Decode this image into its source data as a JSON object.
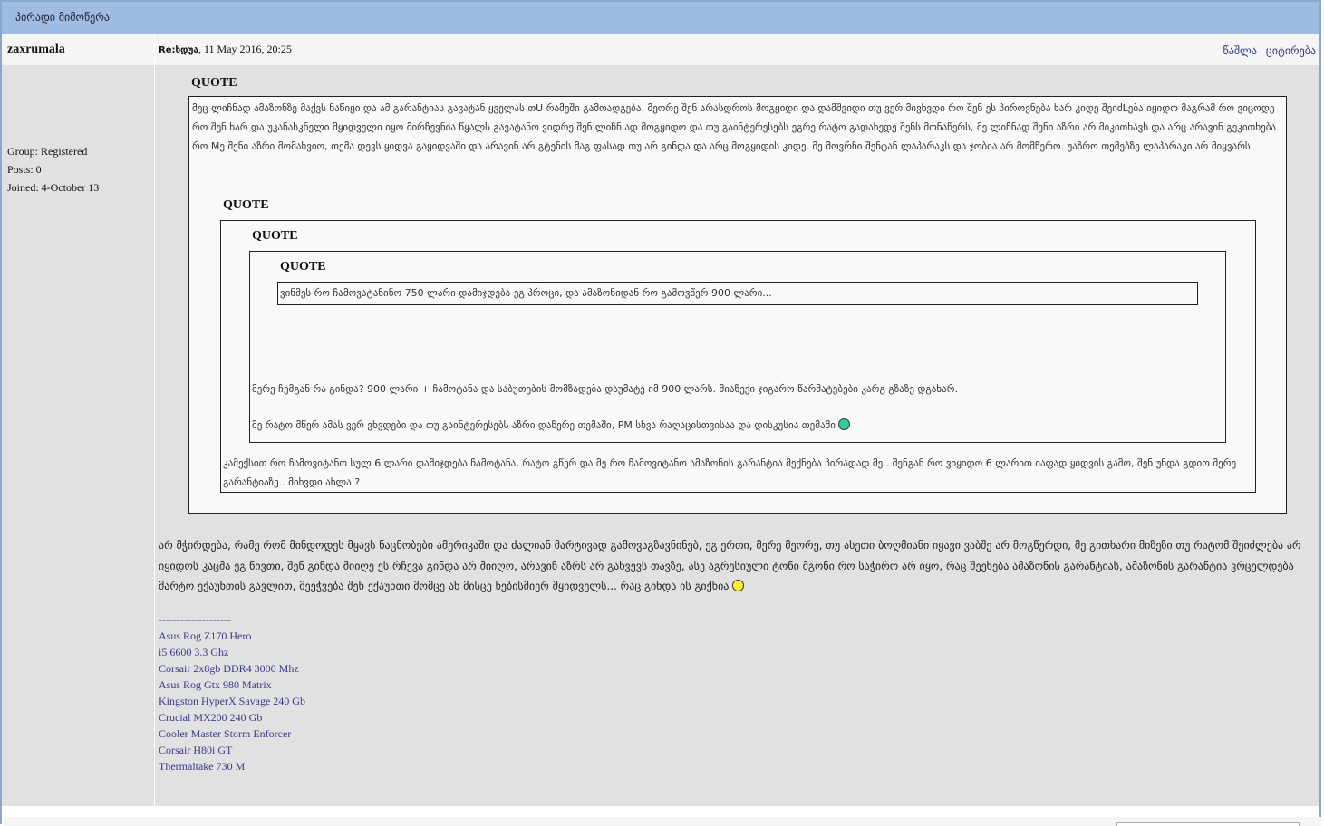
{
  "header": {
    "title": "პირადი მიმოწერა"
  },
  "post": {
    "author": "zaxrumala",
    "subject_prefix": "Re:",
    "subject": "ხდუა",
    "date": ", 11 May 2016, 20:25",
    "actions": {
      "delete": "წაშლა",
      "quote": "ციტირება"
    },
    "user_info": {
      "group": "Group: Registered",
      "posts": "Posts: 0",
      "joined": "Joined: 4-October 13"
    },
    "quote_label": "QUOTE",
    "quote1_text": "მეც ლიჩნად ამაზონზე მაქვს ნაწიყი და ამ გარანტიას გავატან ყველას თU რამეში გამოადგება. მეორე შენ არასდროს მოგყიდი და დამშვიდი თუ ვერ მივხვდი რო შენ ეს პიროვნება ხარ კიდე შეიძLება იყიდო მაგრამ რო ვიცოდე რო შენ ხარ და უკანასკნელი მყიდველი იყო მირჩევნია წყალს გავატანო ვიდრე შენ ლიჩნ ად მოგყიდო და თუ გაინტერესებს ეგრე რატო გადახედე შენს მონაწერს, მე ლიჩნად შენი აზრი არ მიკითხავს და არც არავინ გეკითხება რო Mე შენი აზრი მომახვიო, თემა დევს ყიდვა გაყიდვაში და არავინ არ გტენის მაგ ფასად თუ არ გინდა და არც მოგყიდის კიდე. მე მოვრჩი შენტან ლაპარაკს და ჯობია არ მომწერო. უაზრო თემებზე ლაპარაკი არ მიყვარს",
    "quote4_text": "ვინმეს რო ჩამოვატანინო 750 ლარი დამიჯდება ეგ პროცი, და ამაზონიდან რო გამოვწერ 900 ლარი...",
    "quote3_para1": "მერე ჩემგან რა გინდა? 900 ლარი + ჩამოტანა და საბუთების მომზადება დაუმატე იმ 900 ლარს. მიაწექი ჯიგარო წარმატებები კარგ გზაზე დგახარ.",
    "quote3_para2": "მე რატო მწერ ამას ვერ ვხვდები და თუ გაინტერესებს აზრი დაწერე თემაში, PM სხვა რაღაცისთვისაა და დისკუსია თემაში",
    "quote2_text": "კამექსით რო ჩამოვიტანო სულ 6 ლარი დამიჯდება ჩამოტანა, რატო გწერ და მე რო ჩამოვიტანო ამაზონის გარანტია მექნება პირადად მე.. შენგან რო ვიყიდო 6 ლარით იაფად ყიდვის გამო, შენ უნდა გდიო მერე გარანტიაზე.. მიხვდი ახლა ?",
    "body_text": "არ მჭირდება, რამე რომ მინდოდეს მყავს ნაცნობები ამერიკაში და ძალიან მარტივად გამოვაგზავნინებ, ეგ ერთი, მერე მეორე, თუ ასეთი ბოღმიანი იყავი ვაბშე არ მოგწერდი, მე გითხარი მიზეზი თუ რატომ შეიძლება არ იყიდოს კაცმა ეგ ნივთი, შენ გინდა მიიღე ეს რჩევა გინდა არ მიიღო, არავინ აზრს არ გახვევს თავზე, ასე აგრესიული ტონი მგონი რო საჭირო არ იყო, რაც შეეხება ამაზონის გარანტიას, ამაზონის გარანტია ვრცელდება მარტო ექაუნთის გავლით, მეეჭვება შენ ექაუნთი მომცე ან მისცე ნებისმიერ მყიდველს... რაც გინდა ის გიქნია",
    "signature": {
      "divider": "--------------------",
      "lines": [
        "Asus Rog Z170 Hero",
        "i5 6600 3.3 Ghz",
        "Corsair 2x8gb DDR4 3000 Mhz",
        "Asus Rog Gtx 980 Matrix",
        "Kingston HyperX Savage 240 Gb",
        "Crucial MX200 240 Gb",
        "Cooler Master Storm Enforcer",
        "Corsair H80i GT",
        "Thermaltake 730 M"
      ]
    }
  },
  "colors": {
    "header_bg": "#9fbde3",
    "body_bg": "#e1e1e1",
    "link": "#2a3a8a",
    "signature": "#3a3a8a"
  }
}
